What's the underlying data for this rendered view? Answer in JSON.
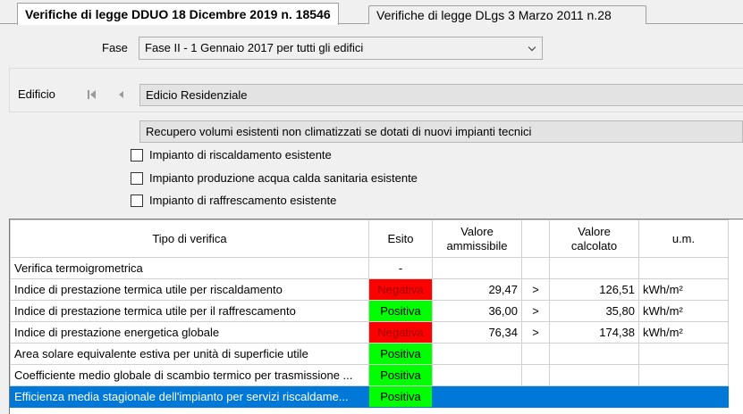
{
  "tabs": [
    {
      "label": "Verifiche di legge DDUO 18 Dicembre 2019 n. 18546",
      "active": true
    },
    {
      "label": "Verifiche di legge DLgs 3 Marzo 2011 n.28",
      "active": false
    }
  ],
  "fase": {
    "label": "Fase",
    "value": "Fase II -  1 Gennaio 2017 per tutti gli edifici"
  },
  "edificio": {
    "label": "Edificio",
    "value": "Edicio Residenziale",
    "subvalue": "Recupero volumi esistenti non climatizzati se dotati di nuovi impianti tecnici"
  },
  "checkboxes": [
    {
      "label": "Impianto di riscaldamento esistente",
      "checked": false
    },
    {
      "label": "Impianto produzione acqua calda sanitaria esistente",
      "checked": false
    },
    {
      "label": "Impianto di raffrescamento esistente",
      "checked": false
    }
  ],
  "table": {
    "headers": {
      "tipo": "Tipo di verifica",
      "esito": "Esito",
      "ammissibile_1": "Valore",
      "ammissibile_2": "ammissibile",
      "op": "",
      "calcolato_1": "Valore",
      "calcolato_2": "calcolato",
      "um": "u.m."
    },
    "rows": [
      {
        "tipo": "Verifica termoigrometrica",
        "esito": "-",
        "esito_state": "none",
        "ammissibile": "",
        "op": "",
        "calcolato": "",
        "um": ""
      },
      {
        "tipo": "Indice di prestazione termica utile per riscaldamento",
        "esito": "Negativa",
        "esito_state": "neg",
        "ammissibile": "29,47",
        "op": ">",
        "calcolato": "126,51",
        "um": "kWh/m²"
      },
      {
        "tipo": "Indice di prestazione termica utile per il raffrescamento",
        "esito": "Positiva",
        "esito_state": "pos",
        "ammissibile": "36,00",
        "op": ">",
        "calcolato": "35,80",
        "um": "kWh/m²"
      },
      {
        "tipo": "Indice di prestazione energetica globale",
        "esito": "Negativa",
        "esito_state": "neg",
        "ammissibile": "76,34",
        "op": ">",
        "calcolato": "174,38",
        "um": "kWh/m²"
      },
      {
        "tipo": "Area solare equivalente estiva per unità di superficie utile",
        "esito": "Positiva",
        "esito_state": "pos",
        "ammissibile": "",
        "op": "",
        "calcolato": "",
        "um": ""
      },
      {
        "tipo": "Coefficiente medio globale di scambio termico per trasmissione ...",
        "esito": "Positiva",
        "esito_state": "pos",
        "ammissibile": "",
        "op": "",
        "calcolato": "",
        "um": ""
      },
      {
        "tipo": "Efficienza media stagionale dell'impianto per servizi riscaldame...",
        "esito": "Positiva",
        "esito_state": "pos",
        "ammissibile": "",
        "op": "",
        "calcolato": "",
        "um": "",
        "selected": true
      }
    ]
  },
  "colors": {
    "negativa": "#ff0000",
    "positiva": "#00ff00",
    "selection": "#0078d7"
  }
}
